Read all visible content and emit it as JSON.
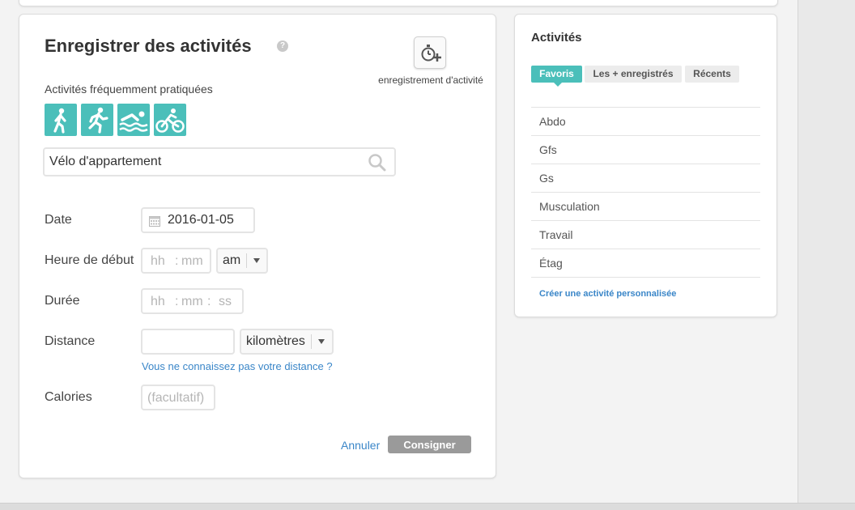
{
  "log": {
    "title": "Enregistrer des activités",
    "help_glyph": "?",
    "timer_label": "enregistrement d'activité",
    "frequent_label": "Activités fréquemment pratiquées",
    "frequent_icons": [
      "walking-icon",
      "running-icon",
      "swimming-icon",
      "cycling-icon"
    ],
    "search": {
      "value": "Vélo d'appartement"
    },
    "date": {
      "label": "Date",
      "value": "2016-01-05"
    },
    "start_time": {
      "label": "Heure de début",
      "hh": "hh",
      "mm": "mm",
      "sep": ":",
      "ampm": "am"
    },
    "duration": {
      "label": "Durée",
      "hh": "hh",
      "mm": "mm",
      "ss": "ss",
      "sep": ":"
    },
    "distance": {
      "label": "Distance",
      "value": "",
      "unit": "kilomètres",
      "help_link": "Vous ne connaissez pas votre distance ?"
    },
    "calories": {
      "label": "Calories",
      "placeholder": "(facultatif)"
    },
    "cancel_label": "Annuler",
    "submit_label": "Consigner"
  },
  "side": {
    "title": "Activités",
    "tabs": [
      {
        "label": "Favoris",
        "active": true
      },
      {
        "label": "Les + enregistrés",
        "active": false
      },
      {
        "label": "Récents",
        "active": false
      }
    ],
    "items": [
      "Abdo",
      "Gfs",
      "Gs",
      "Musculation",
      "Travail",
      "Étag"
    ],
    "create_link": "Créer une activité personnalisée"
  },
  "colors": {
    "accent": "#4bbfba",
    "link": "#3a86c8",
    "button": "#9a9a9a"
  }
}
